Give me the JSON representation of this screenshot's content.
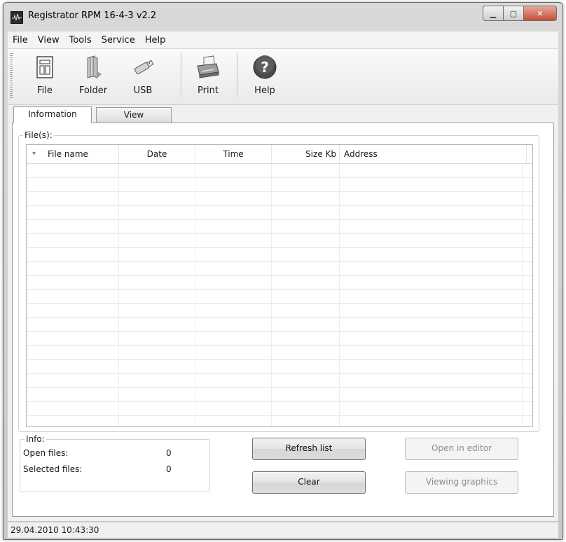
{
  "window": {
    "title": "Registrator RPM 16-4-3 v2.2",
    "controls": {
      "minimize": "▁",
      "maximize": "▢",
      "close": "✕"
    }
  },
  "menu": [
    "File",
    "View",
    "Tools",
    "Service",
    "Help"
  ],
  "toolbar": {
    "file": {
      "label": "File",
      "icon": "file-icon"
    },
    "folder": {
      "label": "Folder",
      "icon": "folder-icon"
    },
    "usb": {
      "label": "USB",
      "icon": "usb-icon"
    },
    "print": {
      "label": "Print",
      "icon": "printer-icon"
    },
    "help": {
      "label": "Help",
      "icon": "help-icon"
    }
  },
  "tabs": {
    "information": "Information",
    "view": "View",
    "active": "Information"
  },
  "files_group": {
    "label": "File(s):",
    "columns": [
      "File name",
      "Date",
      "Time",
      "Size Kb",
      "Address"
    ],
    "sort_indicator": "▾",
    "rows": []
  },
  "info_group": {
    "label": "Info:",
    "open_files_label": "Open files:",
    "open_files_value": "0",
    "selected_files_label": "Selected files:",
    "selected_files_value": "0"
  },
  "buttons": {
    "refresh_list": "Refresh list",
    "clear": "Clear",
    "open_in_editor": "Open in editor",
    "viewing_graphics": "Viewing graphics"
  },
  "status": {
    "datetime": "29.04.2010 10:43:30"
  },
  "colors": {
    "close_button": "#c74e38",
    "frame": "#d0d0d0"
  }
}
